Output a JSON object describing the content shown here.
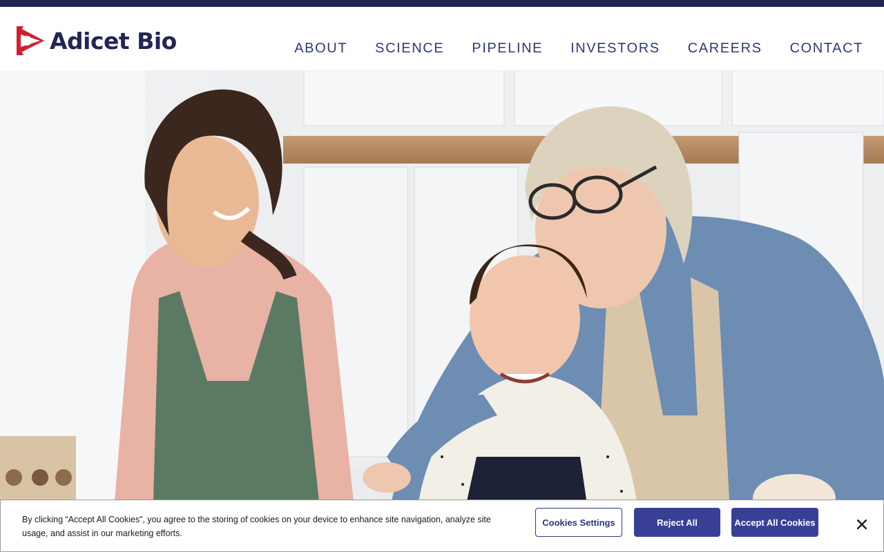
{
  "brand": {
    "name": "Adicet Bio",
    "logo_icon": "adicet-logo-mark",
    "primary_color": "#232654",
    "accent_color": "#d41e2f"
  },
  "nav": {
    "items": [
      {
        "label": "ABOUT"
      },
      {
        "label": "SCIENCE"
      },
      {
        "label": "PIPELINE"
      },
      {
        "label": "INVESTORS"
      },
      {
        "label": "CAREERS"
      },
      {
        "label": "CONTACT"
      }
    ]
  },
  "hero": {
    "image": "family-baking-in-kitchen-photo"
  },
  "cookie_banner": {
    "text": "By clicking “Accept All Cookies”, you agree to the storing of cookies on your device to enhance site navigation, analyze site usage, and assist in our marketing efforts.",
    "settings_label": "Cookies Settings",
    "reject_label": "Reject All",
    "accept_label": "Accept All Cookies",
    "close_icon": "close-icon",
    "button_color": "#3a3f96"
  }
}
